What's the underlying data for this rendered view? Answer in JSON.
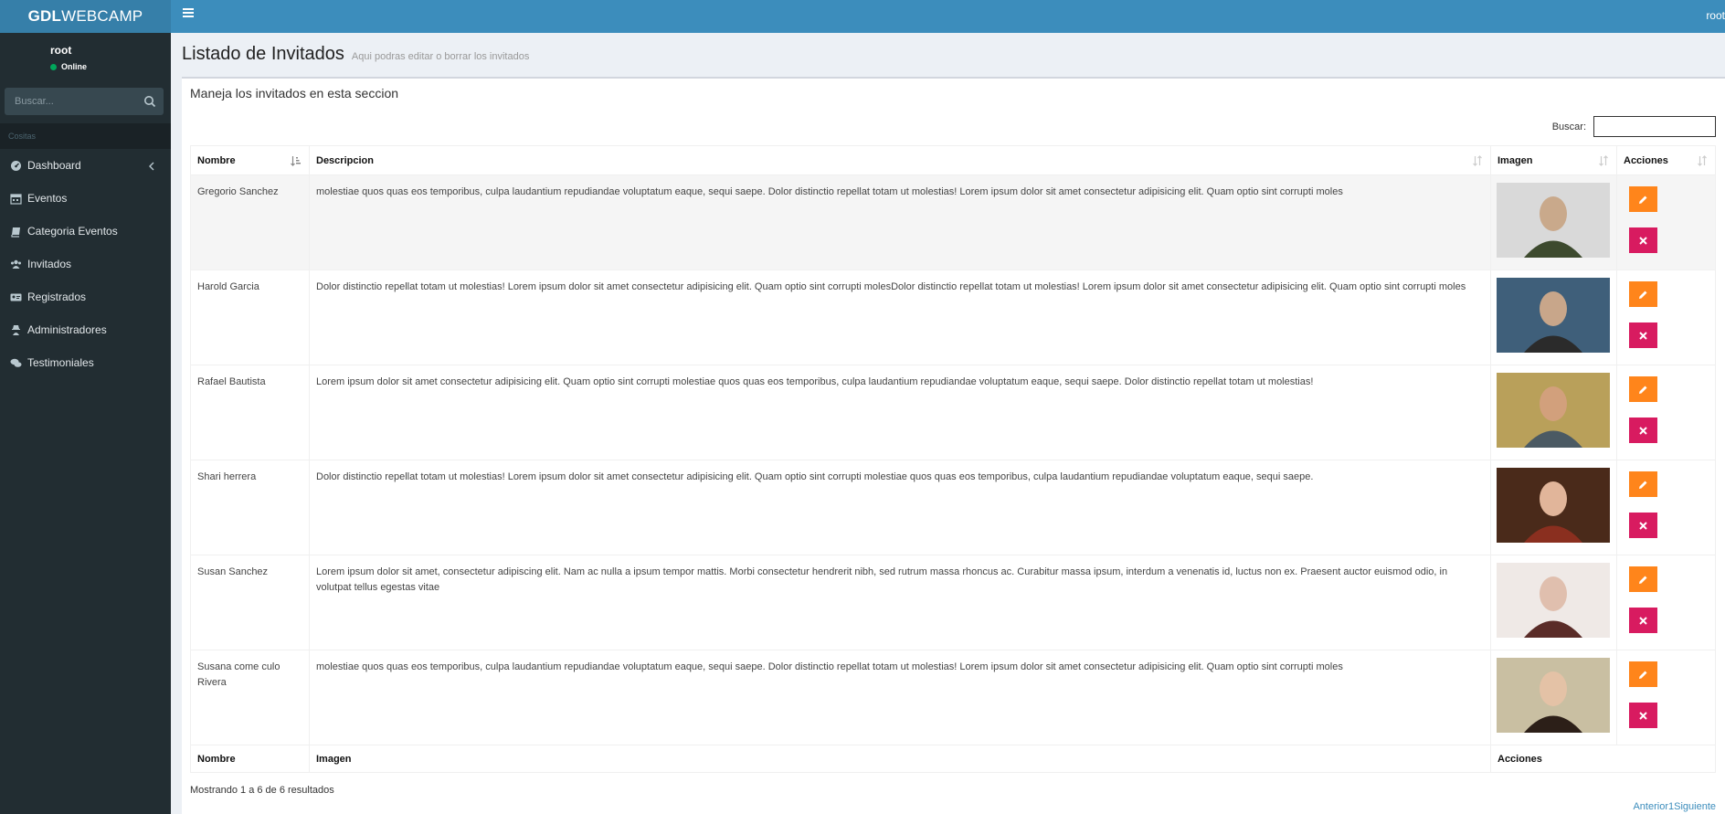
{
  "header": {
    "logo_bold": "GDL",
    "logo_rest": "WEBCAMP",
    "user": "root"
  },
  "sidebar": {
    "user_name": "root",
    "status": "Online",
    "search_placeholder": "Buscar...",
    "section_label": "Cositas",
    "items": [
      {
        "label": "Dashboard",
        "icon": "dashboard-icon"
      },
      {
        "label": "Eventos",
        "icon": "calendar-icon"
      },
      {
        "label": "Categoria Eventos",
        "icon": "book-icon"
      },
      {
        "label": "Invitados",
        "icon": "users-icon"
      },
      {
        "label": "Registrados",
        "icon": "id-card-icon"
      },
      {
        "label": "Administradores",
        "icon": "user-secret-icon"
      },
      {
        "label": "Testimoniales",
        "icon": "comments-icon"
      }
    ]
  },
  "content": {
    "title": "Listado de Invitados",
    "subtitle": "Aqui podras editar o borrar los invitados",
    "box_title": "Maneja los invitados en esta seccion",
    "filter_label": "Buscar:"
  },
  "table": {
    "headers": [
      "Nombre",
      "Descripcion",
      "Imagen",
      "Acciones"
    ],
    "footers": [
      "Nombre",
      "Imagen",
      "Acciones"
    ],
    "rows": [
      {
        "nombre": "Gregorio Sanchez",
        "descripcion": "molestiae quos quas eos temporibus, culpa laudantium repudiandae voluptatum eaque, sequi saepe. Dolor distinctio repellat totam ut molestias! Lorem ipsum dolor sit amet consectetur adipisicing elit. Quam optio sint corrupti moles"
      },
      {
        "nombre": "Harold Garcia",
        "descripcion": "Dolor distinctio repellat totam ut molestias! Lorem ipsum dolor sit amet consectetur adipisicing elit. Quam optio sint corrupti molesDolor distinctio repellat totam ut molestias! Lorem ipsum dolor sit amet consectetur adipisicing elit. Quam optio sint corrupti moles"
      },
      {
        "nombre": "Rafael Bautista",
        "descripcion": "Lorem ipsum dolor sit amet consectetur adipisicing elit. Quam optio sint corrupti molestiae quos quas eos temporibus, culpa laudantium repudiandae voluptatum eaque, sequi saepe. Dolor distinctio repellat totam ut molestias!"
      },
      {
        "nombre": "Shari herrera",
        "descripcion": "Dolor distinctio repellat totam ut molestias! Lorem ipsum dolor sit amet consectetur adipisicing elit. Quam optio sint corrupti molestiae quos quas eos temporibus, culpa laudantium repudiandae voluptatum eaque, sequi saepe."
      },
      {
        "nombre": "Susan Sanchez",
        "descripcion": "Lorem ipsum dolor sit amet, consectetur adipiscing elit. Nam ac nulla a ipsum tempor mattis. Morbi consectetur hendrerit nibh, sed rutrum massa rhoncus ac. Curabitur massa ipsum, interdum a venenatis id, luctus non ex. Praesent auctor euismod odio, in volutpat tellus egestas vitae"
      },
      {
        "nombre": "Susana come culo Rivera",
        "descripcion": "molestiae quos quas eos temporibus, culpa laudantium repudiandae voluptatum eaque, sequi saepe. Dolor distinctio repellat totam ut molestias! Lorem ipsum dolor sit amet consectetur adipisicing elit. Quam optio sint corrupti moles"
      }
    ]
  },
  "footer": {
    "info": "Mostrando 1 a 6 de 6 resultados",
    "prev": "Anterior",
    "page": "1",
    "next": "Siguiente"
  },
  "colors": {
    "navbar": "#3c8dbc",
    "logo_bg": "#367fa9",
    "sidebar": "#222d32",
    "edit_button": "#ff851b",
    "delete_button": "#d81b60",
    "online": "#00a65a"
  }
}
